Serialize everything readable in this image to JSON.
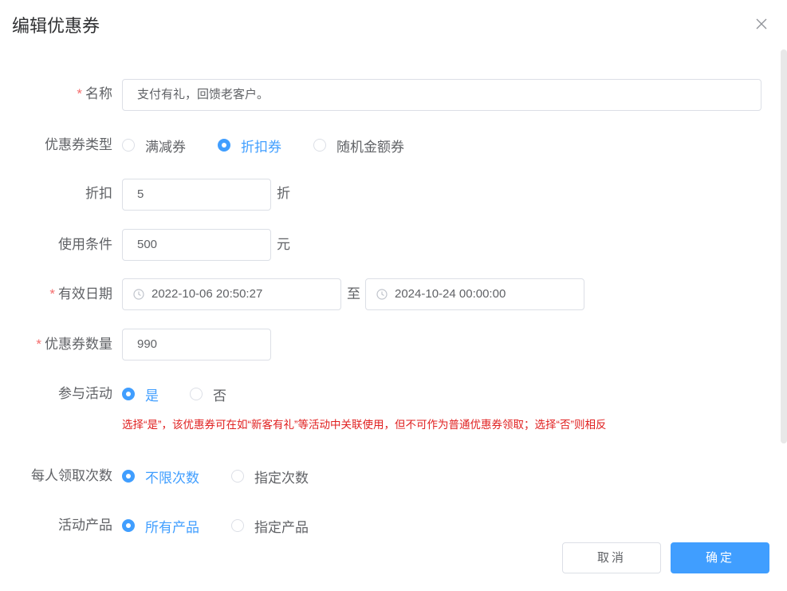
{
  "dialog": {
    "title": "编辑优惠券",
    "close_icon": "close-icon"
  },
  "form": {
    "name": {
      "label": "名称",
      "required_mark": "*",
      "value": "支付有礼，回馈老客户。"
    },
    "coupon_type": {
      "label": "优惠券类型",
      "options": [
        "满减券",
        "折扣券",
        "随机金额券"
      ],
      "selected": "折扣券"
    },
    "discount": {
      "label": "折扣",
      "value": "5",
      "unit": "折"
    },
    "condition": {
      "label": "使用条件",
      "value": "500",
      "unit": "元"
    },
    "valid_date": {
      "label": "有效日期",
      "required_mark": "*",
      "start": "2022-10-06 20:50:27",
      "separator": "至",
      "end": "2024-10-24 00:00:00",
      "icon": "clock-icon"
    },
    "quantity": {
      "label": "优惠券数量",
      "required_mark": "*",
      "value": "990"
    },
    "join_activity": {
      "label": "参与活动",
      "options": [
        "是",
        "否"
      ],
      "selected": "是",
      "hint": "选择“是”，该优惠券可在如“新客有礼”等活动中关联使用，但不可作为普通优惠券领取；选择“否”则相反"
    },
    "per_user_limit": {
      "label": "每人领取次数",
      "options": [
        "不限次数",
        "指定次数"
      ],
      "selected": "不限次数"
    },
    "products": {
      "label": "活动产品",
      "options": [
        "所有产品",
        "指定产品"
      ],
      "selected": "所有产品"
    }
  },
  "footer": {
    "cancel_label": "取消",
    "confirm_label": "确定"
  },
  "colors": {
    "primary": "#409eff",
    "required": "#f56c6c",
    "hint": "#e02020",
    "border": "#dcdfe6"
  }
}
